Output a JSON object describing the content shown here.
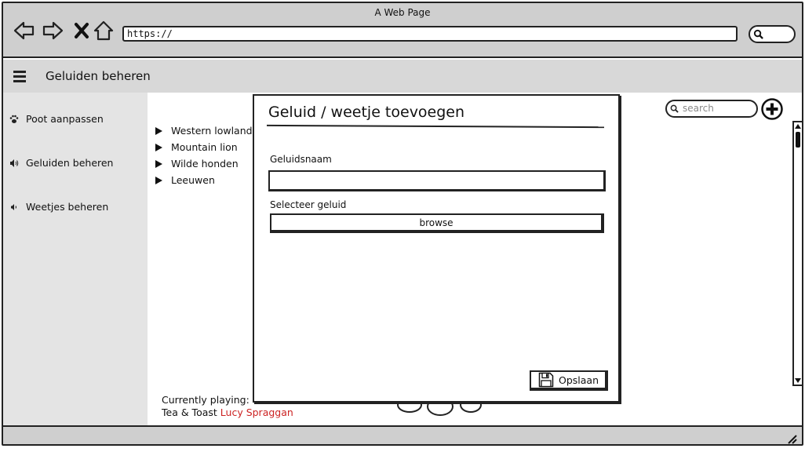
{
  "browser": {
    "title": "A Web Page",
    "url": "https://"
  },
  "app": {
    "title": "Geluiden beheren"
  },
  "sidebar": {
    "items": [
      {
        "label": "Poot aanpassen",
        "icon": "paw-icon"
      },
      {
        "label": "Geluiden beheren",
        "icon": "volume-icon"
      },
      {
        "label": "Weetjes beheren",
        "icon": "volume-low-icon"
      }
    ]
  },
  "main": {
    "search_placeholder": "search",
    "sounds": [
      {
        "label": "Western lowland g"
      },
      {
        "label": "Mountain lion"
      },
      {
        "label": "Wilde honden"
      },
      {
        "label": "Leeuwen"
      }
    ],
    "player": {
      "heading": "Currently playing:",
      "track": "Tea & Toast",
      "artist": "Lucy Spraggan",
      "artist_color": "#cc2222"
    }
  },
  "modal": {
    "title": "Geluid / weetje toevoegen",
    "name_label": "Geluidsnaam",
    "name_value": "",
    "sound_label": "Selecteer geluid",
    "browse_label": "browse",
    "save_label": "Opslaan"
  }
}
